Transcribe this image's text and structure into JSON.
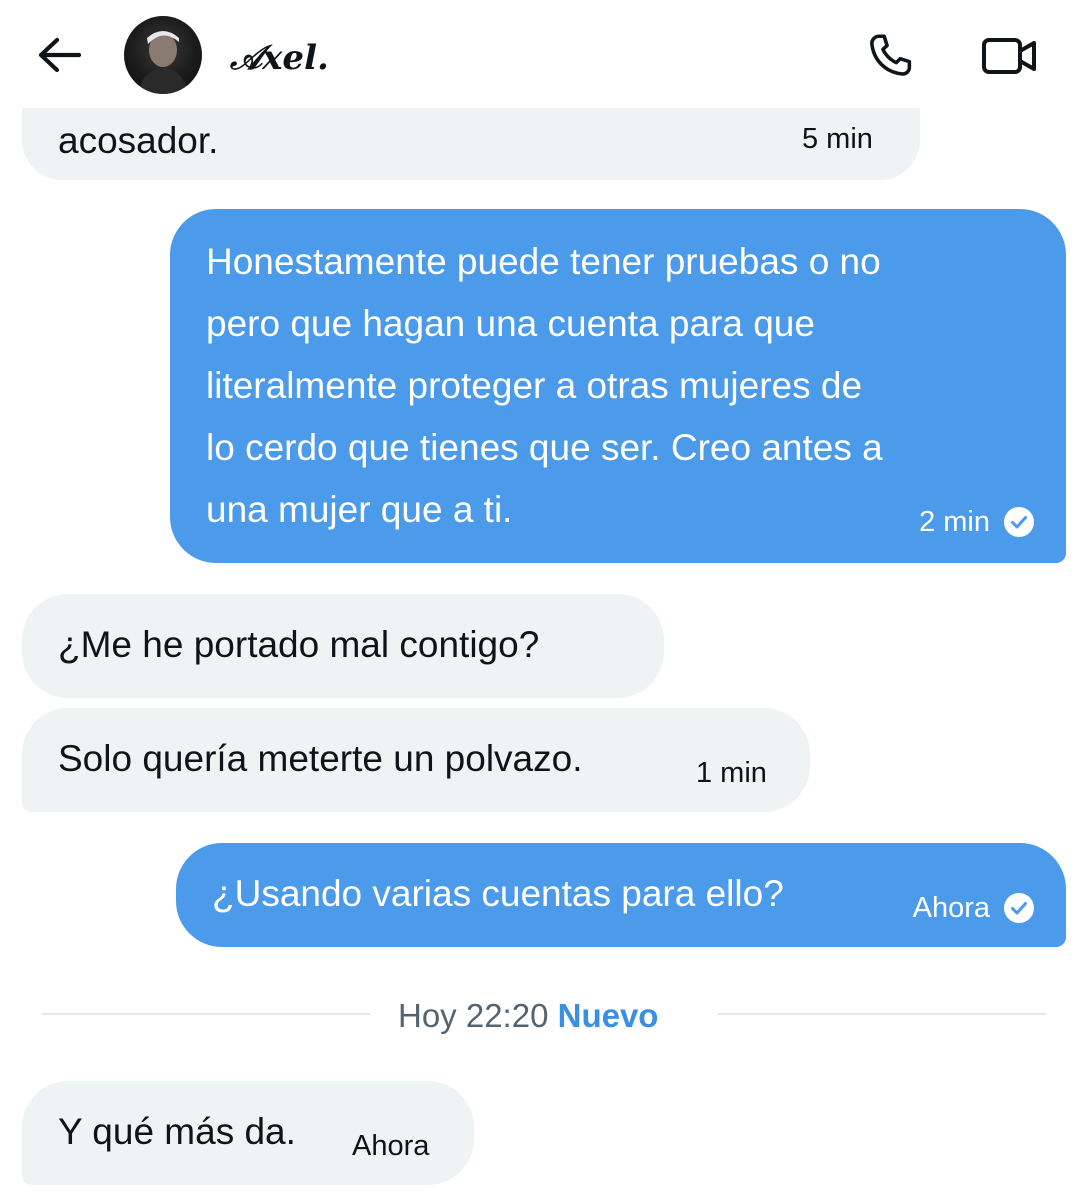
{
  "header": {
    "contact_name": "𝒜xel.",
    "back_icon": "arrow-left-icon",
    "call_icon": "phone-icon",
    "video_icon": "video-camera-icon"
  },
  "messages": [
    {
      "direction": "received",
      "text": "acosador.",
      "time": "5 min"
    },
    {
      "direction": "sent",
      "lines": [
        "Honestamente puede tener pruebas o no",
        "pero que hagan una cuenta para que",
        "literalmente proteger a otras mujeres de",
        "lo cerdo que tienes que ser. Creo antes a",
        "una mujer que a ti."
      ],
      "time": "2 min",
      "status": "read"
    },
    {
      "direction": "received",
      "text": "¿Me he portado mal contigo?"
    },
    {
      "direction": "received",
      "text": "Solo quería meterte un polvazo.",
      "time": "1 min"
    },
    {
      "direction": "sent",
      "text": "¿Usando varias cuentas para ello?",
      "time": "Ahora",
      "status": "read"
    },
    {
      "direction": "received",
      "text": "Y qué más da.",
      "time": "Ahora"
    }
  ],
  "divider": {
    "date": "Hoy 22:20",
    "new_label": "Nuevo"
  },
  "colors": {
    "sent_bubble": "#4c9bea",
    "received_bubble": "#eff3f4",
    "accent": "#3b8fe0",
    "muted": "#536471"
  }
}
